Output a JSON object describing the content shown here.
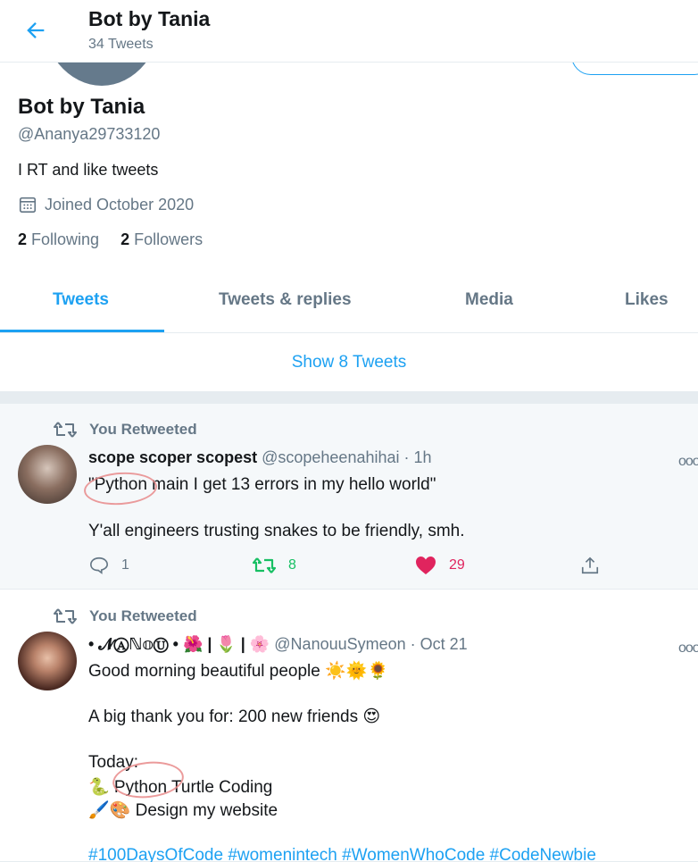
{
  "header": {
    "title": "Bot by Tania",
    "subtitle": "34 Tweets"
  },
  "profile": {
    "name": "Bot by Tania",
    "handle": "@Ananya29733120",
    "bio": "I RT and like tweets",
    "joined": "Joined October 2020",
    "following_count": "2",
    "following_label": "Following",
    "followers_count": "2",
    "followers_label": "Followers"
  },
  "tabs": [
    {
      "label": "Tweets"
    },
    {
      "label": "Tweets & replies"
    },
    {
      "label": "Media"
    },
    {
      "label": "Likes"
    }
  ],
  "show_more": "Show 8 Tweets",
  "tweets": [
    {
      "retweet_label": "You Retweeted",
      "author_name": "scope scoper scopest",
      "author_handle": "@scopeheenahihai",
      "time": "· 1h",
      "lines": [
        "\"Python main I get 13 errors in my hello world\"",
        "Y'all engineers trusting snakes to be friendly, smh."
      ],
      "reply_count": "1",
      "retweet_count": "8",
      "like_count": "29"
    },
    {
      "retweet_label": "You Retweeted",
      "author_name": "• 𝓝Ⓐℕ𝕠Ⓤ • 🌺 | 🌷 | 🌸",
      "author_handle": "@NanouuSymeon",
      "time": "· Oct 21",
      "lines": [
        "Good morning beautiful people ☀️🌞🌻",
        "A big thank you for: 200 new friends 😍",
        "Today:",
        "🐍 Python Turtle Coding",
        "🖌️🎨 Design my website"
      ],
      "hashtags": "#100DaysOfCode #womenintech #WomenWhoCode #CodeNewbie"
    }
  ],
  "colors": {
    "accent": "#1da1f2",
    "retweet_green": "#17bf63",
    "like_red": "#e0245e",
    "muted": "#657786"
  }
}
